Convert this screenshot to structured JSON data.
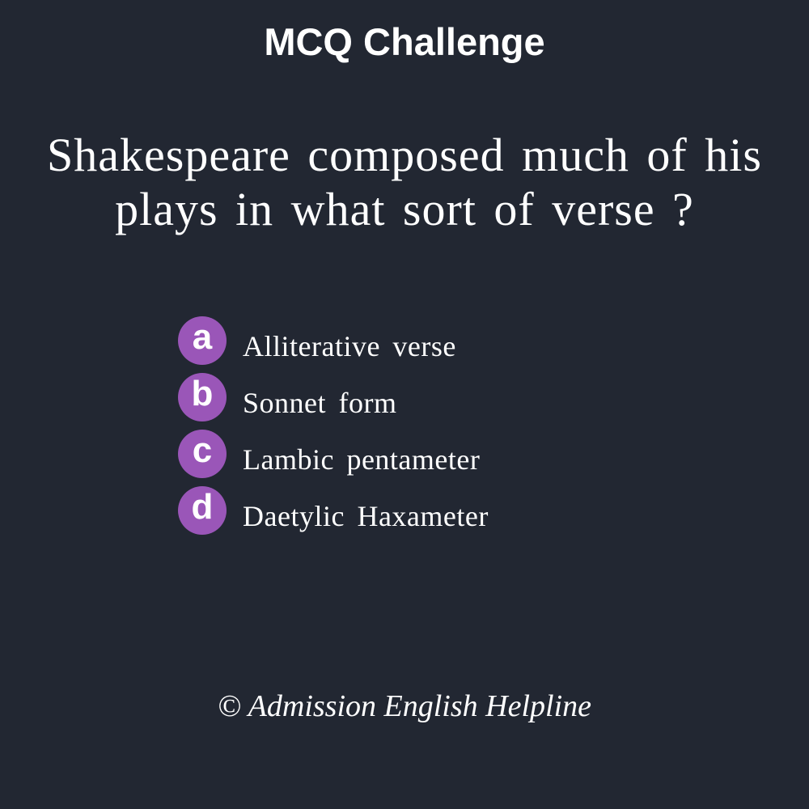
{
  "header": {
    "title": "MCQ Challenge"
  },
  "question": {
    "text": "Shakespeare composed much of his plays in what sort of verse ?"
  },
  "options": [
    {
      "letter": "a",
      "text": "Alliterative verse"
    },
    {
      "letter": "b",
      "text": "Sonnet form"
    },
    {
      "letter": "c",
      "text": "Lambic pentameter"
    },
    {
      "letter": "d",
      "text": "Daetylic Haxameter"
    }
  ],
  "footer": {
    "credit": "© Admission English Helpline"
  },
  "colors": {
    "background": "#222732",
    "badge": "#9a56b8",
    "text": "#ffffff"
  }
}
